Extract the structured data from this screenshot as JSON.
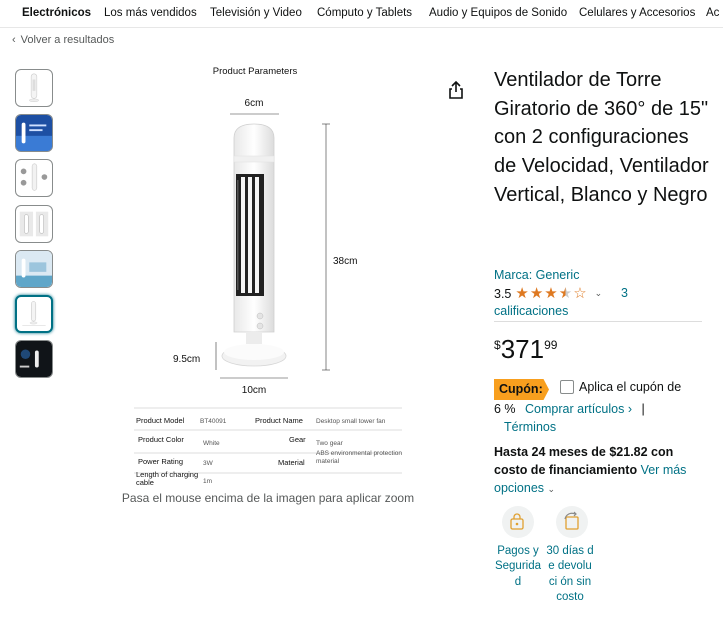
{
  "nav": {
    "items": [
      "Electrónicos",
      "Los más vendidos",
      "Televisión y Video",
      "Cómputo y Tablets",
      "Audio y Equipos de Sonido",
      "Celulares y Accesorios",
      "Ac"
    ]
  },
  "back_link": {
    "icon": "chevron-left-icon",
    "label": "Volver a resultados"
  },
  "thumbnails": [
    {
      "name": "white-tower-fan-thumb"
    },
    {
      "name": "blue-promo-thumb"
    },
    {
      "name": "features-thumb"
    },
    {
      "name": "sizes-thumb"
    },
    {
      "name": "room-scene-thumb"
    },
    {
      "name": "product-parameters-thumb"
    },
    {
      "name": "dark-scene-thumb"
    }
  ],
  "main_image": {
    "heading": "Product Parameters",
    "dims": {
      "top": "6cm",
      "height": "38cm",
      "base_height": "9.5cm",
      "base_width": "10cm"
    },
    "table": [
      {
        "k1": "Product Model",
        "v1": "BT40091",
        "k2": "Product Name",
        "v2": "Desktop small tower fan"
      },
      {
        "k1": "Product Color",
        "v1": "White",
        "k2": "Gear",
        "v2": "Two gear"
      },
      {
        "k1": "Power Rating",
        "v1": "3W",
        "k2": "Material",
        "v2": "ABS environmental protection material"
      },
      {
        "k1": "Length of charging cable",
        "v1": "1m",
        "k2": "",
        "v2": ""
      }
    ]
  },
  "zoom_hint": "Pasa el mouse encima de la imagen para aplicar zoom",
  "share_icon": "share-icon",
  "product": {
    "title": "Ventilador de Torre Giratorio de 360° de 15\" con 2 configuraciones de Velocidad, Ventilador Vertical, Blanco y Negro",
    "brand": "Marca: Generic",
    "rating": "3.5",
    "rating_value": 3.5,
    "ratings_count": "3",
    "ratings_label": "calificaciones",
    "price_symbol": "$",
    "price_whole": "371",
    "price_fraction": "99"
  },
  "coupon": {
    "badge": "Cupón:",
    "text": "Aplica el cupón de",
    "percent": "6 %",
    "link": "Comprar artículos ›",
    "separator": "|",
    "terms": "Términos"
  },
  "financing": {
    "bold": "Hasta 24 meses de $21.82 con costo de financiamiento",
    "more": "Ver más opciones",
    "more_icon": "chevron-down-icon"
  },
  "benefits": [
    {
      "icon": "secure-payment-icon",
      "label": "Pagos y Segurida d"
    },
    {
      "icon": "returns-icon",
      "label": "30 días de devoluci ón sin costo"
    }
  ],
  "colors": {
    "link": "#007185",
    "star": "#de7921",
    "coupon": "#f89f1e"
  }
}
